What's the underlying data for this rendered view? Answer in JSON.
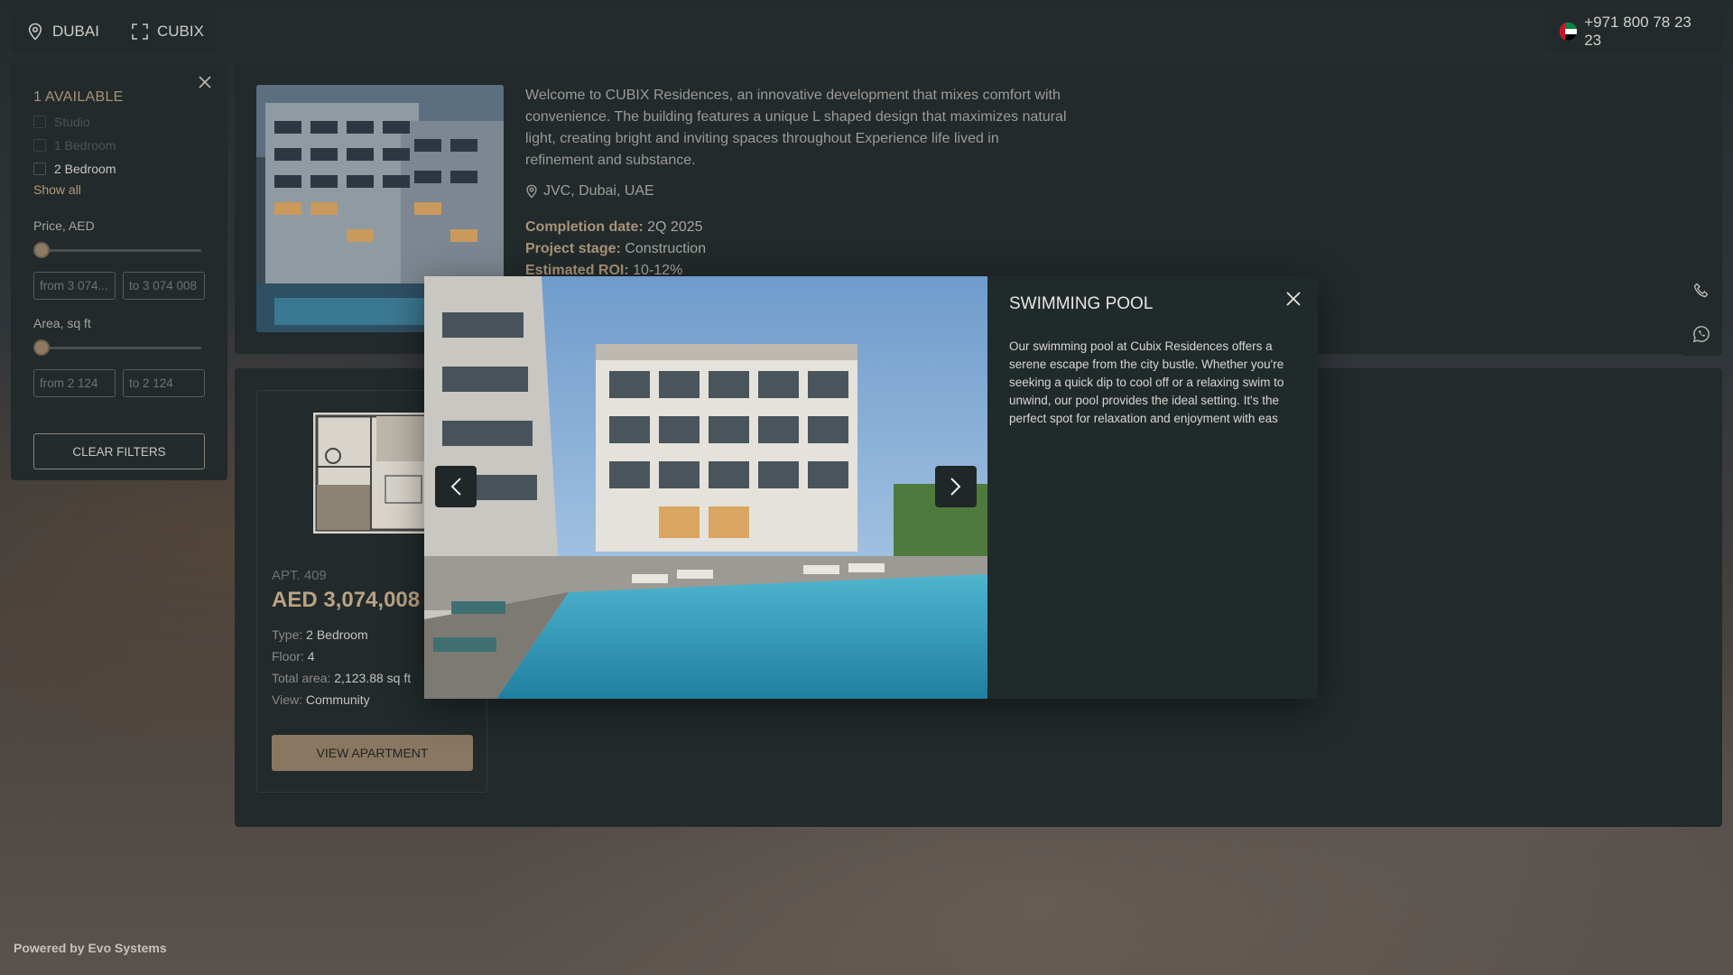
{
  "header": {
    "city": "DUBAI",
    "project": "CUBIX",
    "phone": "+971 800 78 23 23"
  },
  "filters": {
    "available": "1 AVAILABLE",
    "types": [
      {
        "label": "Studio",
        "enabled": false
      },
      {
        "label": "1 Bedroom",
        "enabled": false
      },
      {
        "label": "2 Bedroom",
        "enabled": true
      }
    ],
    "show_all": "Show all",
    "price": {
      "label": "Price, AED",
      "from_placeholder": "from 3 074...",
      "to_placeholder": "to 3 074 008",
      "slider_position": 0
    },
    "area": {
      "label": "Area, sq ft",
      "from_placeholder": "from 2 124",
      "to_placeholder": "to 2 124",
      "slider_position": 0
    },
    "clear_label": "CLEAR FILTERS"
  },
  "project_info": {
    "description": "Welcome to CUBIX Residences, an innovative development that mixes comfort with convenience. The building features a unique L shaped design that maximizes natural light, creating bright and inviting spaces throughout Experience life lived in refinement and substance.",
    "address": "JVC, Dubai, UAE",
    "completion_label": "Completion date:",
    "completion_value": "2Q 2025",
    "stage_label": "Project stage:",
    "stage_value": "Construction",
    "roi_label": "Estimated ROI:",
    "roi_value": "10-12%"
  },
  "listing": {
    "apt": "APT. 409",
    "price": "AED 3,074,008",
    "type_label": "Type:",
    "type_value": "2 Bedroom",
    "floor_label": "Floor:",
    "floor_value": "4",
    "area_label": "Total area:",
    "area_value": "2,123.88 sq ft",
    "view_label": "View:",
    "view_value": "Community",
    "button": "VIEW APARTMENT"
  },
  "modal": {
    "title": "SWIMMING POOL",
    "text": "Our swimming pool at Cubix Residences offers a serene escape from the city bustle. Whether you're seeking a quick dip to cool off or a relaxing swim to unwind, our pool provides the ideal setting. It's the perfect spot for relaxation and enjoyment with eas"
  },
  "footer": {
    "powered": "Powered by Evo Systems"
  },
  "colors": {
    "accent": "#a99479",
    "panel": "#222a2b",
    "button": "#8a7761"
  }
}
